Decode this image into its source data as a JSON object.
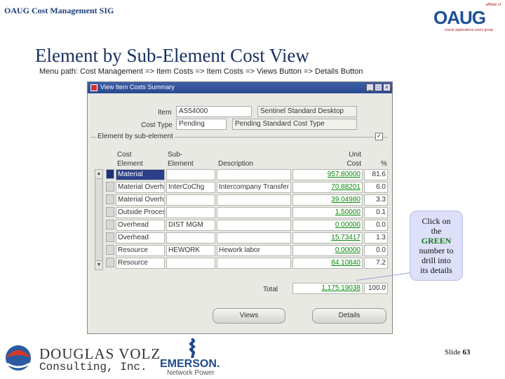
{
  "header": {
    "sig": "OAUG Cost Management SIG",
    "title": "Element by Sub-Element Cost View",
    "menu_path": "Menu path:  Cost Management => Item Costs  => Item Costs => Views Button => Details Button"
  },
  "oaug_logo": {
    "affiliate": "affiliate of",
    "word": "OAUG",
    "tagline": "oracle applications users group"
  },
  "window": {
    "title": "View Item Costs Summary",
    "item_label": "Item",
    "item_value": "AS54000",
    "item_desc": "Sentinel Standard Desktop",
    "cost_type_label": "Cost Type",
    "cost_type_value": "Pending",
    "cost_type_desc": "Pending Standard Cost Type",
    "group_label": "Element by sub-element",
    "columns": {
      "cost_element": [
        "Cost",
        "Element"
      ],
      "sub_element": [
        "Sub-",
        "Element"
      ],
      "description": "Description",
      "unit_cost": [
        "Unit",
        "Cost"
      ],
      "pct": "%"
    },
    "rows": [
      {
        "element": "Material",
        "sub": "",
        "desc": "",
        "cost": "957.80000",
        "pct": "81.6"
      },
      {
        "element": "Material Overhe",
        "sub": "InterCoChg",
        "desc": "Intercompany Transfer C",
        "cost": "70.88201",
        "pct": "6.0"
      },
      {
        "element": "Material Overhe",
        "sub": "",
        "desc": "",
        "cost": "39.04980",
        "pct": "3.3"
      },
      {
        "element": "Outside Process",
        "sub": "",
        "desc": "",
        "cost": "1.50000",
        "pct": "0.1"
      },
      {
        "element": "Overhead",
        "sub": "DIST MGM",
        "desc": "",
        "cost": "0.00000",
        "pct": "0.0"
      },
      {
        "element": "Overhead",
        "sub": "",
        "desc": "",
        "cost": "15.73417",
        "pct": "1.3"
      },
      {
        "element": "Resource",
        "sub": "HEWORK",
        "desc": "Hework labor",
        "cost": "0.00000",
        "pct": "0.0"
      },
      {
        "element": "Resource",
        "sub": "",
        "desc": "",
        "cost": "84.10840",
        "pct": "7.2"
      }
    ],
    "total_label": "Total",
    "total_value": "1,175.19038",
    "total_pct": "100.0",
    "views_button": "Views",
    "details_button": "Details"
  },
  "callout": {
    "line1": "Click on",
    "line2": "the",
    "line3": "GREEN",
    "line4": "number to",
    "line5": "drill into",
    "line6": "its details"
  },
  "footer": {
    "dv_top": "DOUGLAS VOLZ",
    "dv_bottom": "Consulting, Inc.",
    "emerson": "EMERSON.",
    "emerson_sub": "Network Power",
    "slide_prefix": "Slide ",
    "slide_number": "63"
  },
  "colors": {
    "green_number": "#0a8a0a",
    "title_blue": "#17305e",
    "titlebar": "#2a4a92",
    "callout_bg": "#dde0f8"
  }
}
